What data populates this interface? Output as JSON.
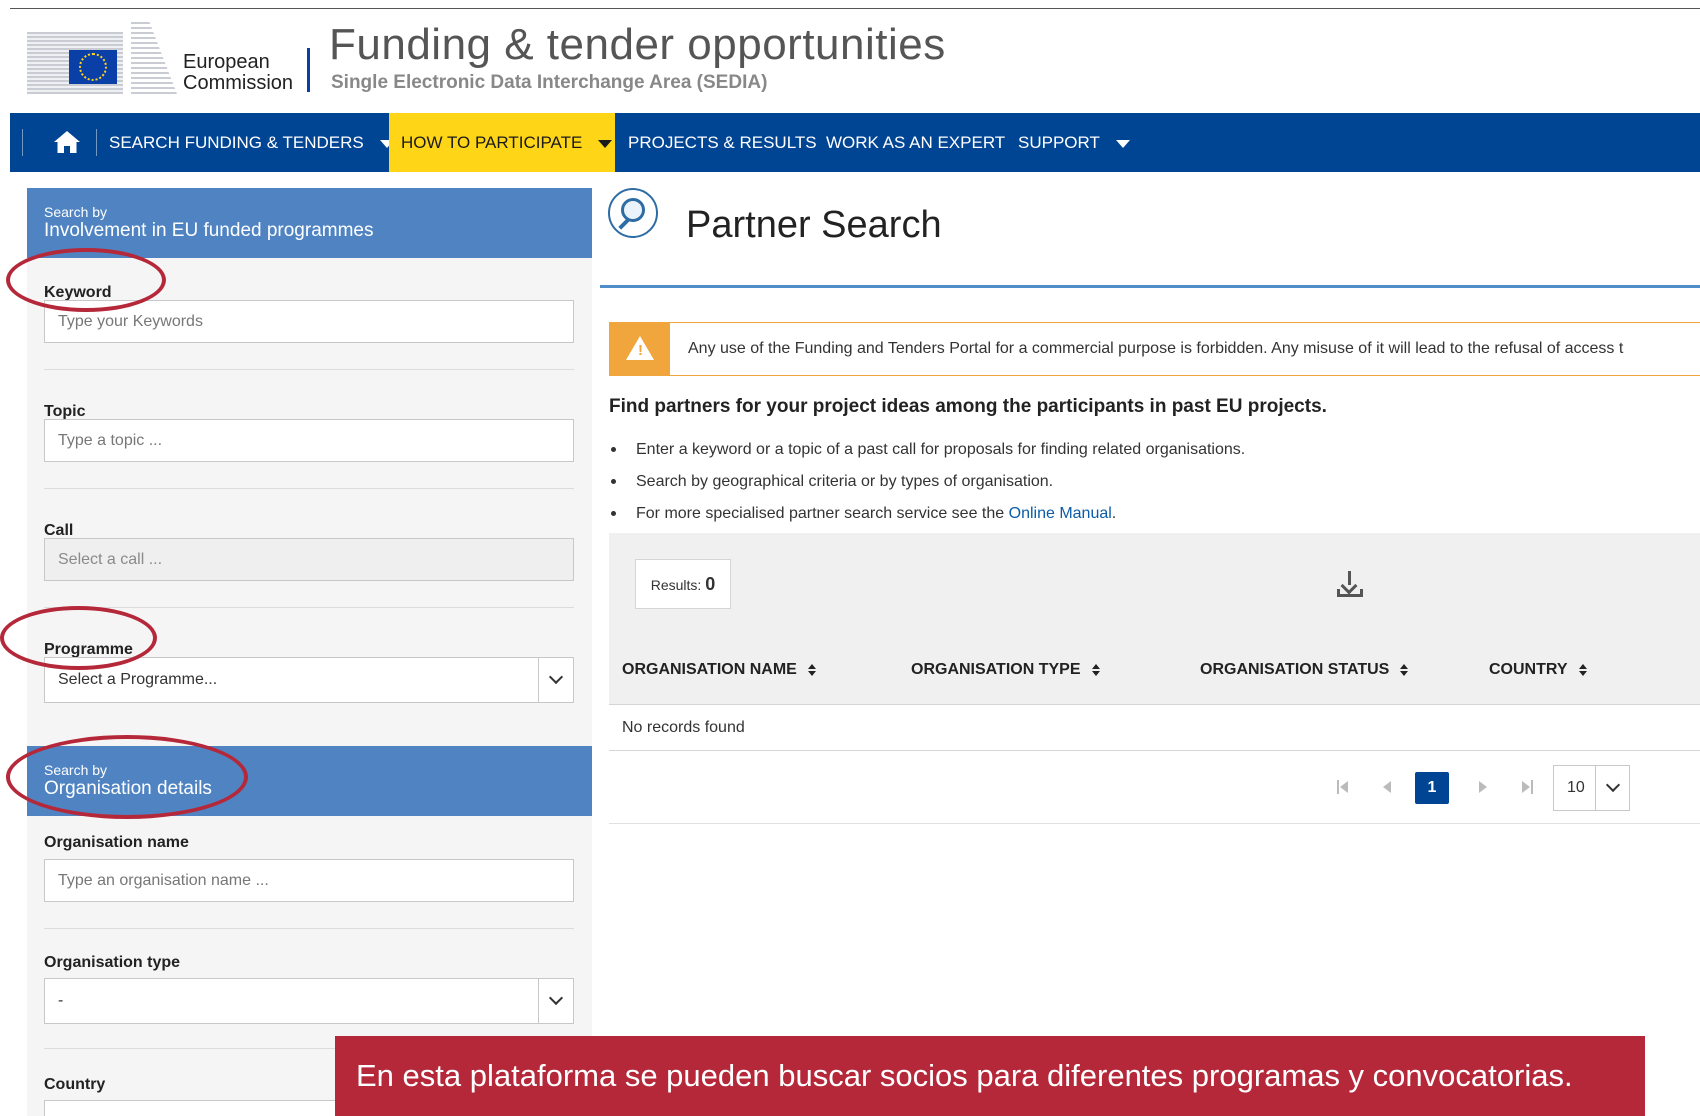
{
  "header": {
    "org_line1": "European",
    "org_line2": "Commission",
    "portal_title": "Funding & tender opportunities",
    "portal_subtitle": "Single Electronic Data Interchange Area (SEDIA)"
  },
  "nav": {
    "home_icon": "home-icon",
    "items": [
      {
        "label": "SEARCH FUNDING & TENDERS",
        "has_dropdown": true
      },
      {
        "label": "HOW TO PARTICIPATE",
        "has_dropdown": true,
        "active": true
      },
      {
        "label": "PROJECTS & RESULTS"
      },
      {
        "label": "WORK AS AN EXPERT"
      },
      {
        "label": "SUPPORT",
        "has_dropdown": true
      }
    ]
  },
  "left": {
    "section1": {
      "small": "Search by",
      "big": "Involvement in EU funded programmes"
    },
    "keyword": {
      "label": "Keyword",
      "placeholder": "Type your Keywords"
    },
    "topic": {
      "label": "Topic",
      "placeholder": "Type a topic ..."
    },
    "call": {
      "label": "Call",
      "placeholder": "Select a call ..."
    },
    "programme": {
      "label": "Programme",
      "value": "Select a Programme..."
    },
    "section2": {
      "small": "Search by",
      "big": "Organisation details"
    },
    "org_name": {
      "label": "Organisation name",
      "placeholder": "Type an organisation name ..."
    },
    "org_type": {
      "label": "Organisation type",
      "value": "-"
    },
    "country": {
      "label": "Country"
    }
  },
  "main": {
    "title": "Partner Search",
    "alert": "Any use of the Funding and Tenders Portal for a commercial purpose is forbidden. Any misuse of it will lead to the refusal of access t",
    "intro": "Find partners for your project ideas among the participants in past EU projects.",
    "bullets": [
      "Enter a keyword or a topic of a past call for proposals for finding related organisations.",
      "Search by geographical criteria or by types of organisation.",
      "For more specialised partner search service see the"
    ],
    "manual_link": "Online Manual",
    "manual_tail": ".",
    "results_label": "Results:",
    "results_count": "0",
    "columns": [
      "ORGANISATION NAME",
      "ORGANISATION TYPE",
      "ORGANISATION STATUS",
      "COUNTRY"
    ],
    "no_records": "No records found",
    "current_page": "1",
    "page_size": "10"
  },
  "caption": "En esta plataforma se pueden buscar socios para diferentes programas y convocatorias.",
  "colors": {
    "nav_bg": "#004494",
    "nav_active": "#ffd617",
    "section_bg": "#4f83c2",
    "annotation": "#b5283a",
    "alert": "#f0a63c"
  }
}
